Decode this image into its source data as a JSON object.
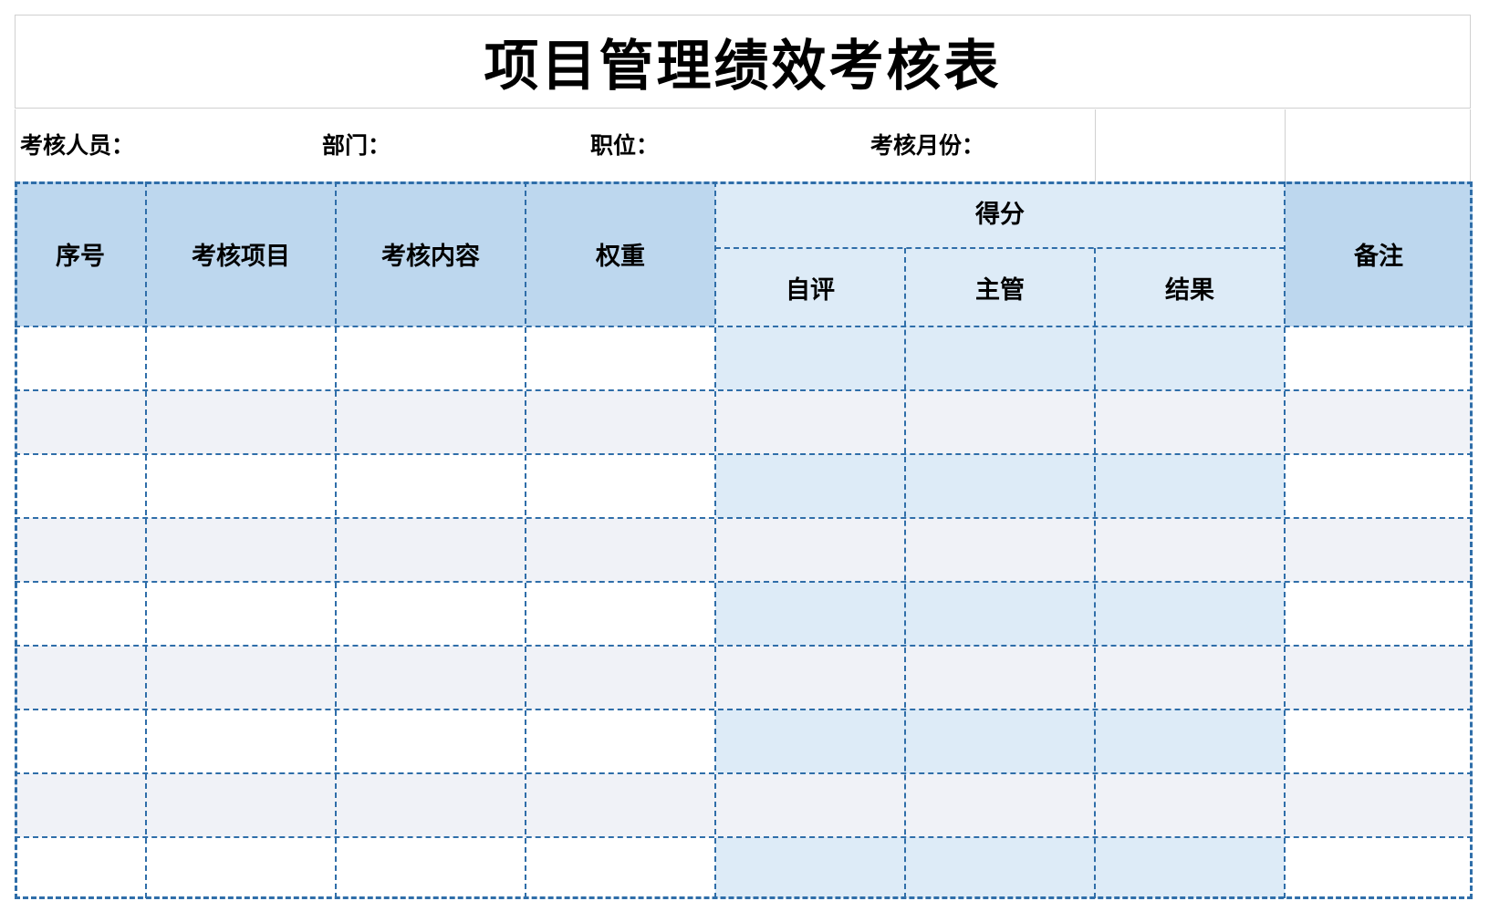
{
  "title": "项目管理绩效考核表",
  "info": {
    "reviewer_label": "考核人员：",
    "department_label": "部门：",
    "position_label": "职位：",
    "month_label": "考核月份："
  },
  "header": {
    "index": "序号",
    "item": "考核项目",
    "content": "考核内容",
    "weight": "权重",
    "score_group": "得分",
    "self_eval": "自评",
    "supervisor": "主管",
    "result": "结果",
    "remarks": "备注"
  },
  "rows": [
    {
      "index": "",
      "item": "",
      "content": "",
      "weight": "",
      "self_eval": "",
      "supervisor": "",
      "result": "",
      "remarks": ""
    },
    {
      "index": "",
      "item": "",
      "content": "",
      "weight": "",
      "self_eval": "",
      "supervisor": "",
      "result": "",
      "remarks": ""
    },
    {
      "index": "",
      "item": "",
      "content": "",
      "weight": "",
      "self_eval": "",
      "supervisor": "",
      "result": "",
      "remarks": ""
    },
    {
      "index": "",
      "item": "",
      "content": "",
      "weight": "",
      "self_eval": "",
      "supervisor": "",
      "result": "",
      "remarks": ""
    },
    {
      "index": "",
      "item": "",
      "content": "",
      "weight": "",
      "self_eval": "",
      "supervisor": "",
      "result": "",
      "remarks": ""
    },
    {
      "index": "",
      "item": "",
      "content": "",
      "weight": "",
      "self_eval": "",
      "supervisor": "",
      "result": "",
      "remarks": ""
    },
    {
      "index": "",
      "item": "",
      "content": "",
      "weight": "",
      "self_eval": "",
      "supervisor": "",
      "result": "",
      "remarks": ""
    },
    {
      "index": "",
      "item": "",
      "content": "",
      "weight": "",
      "self_eval": "",
      "supervisor": "",
      "result": "",
      "remarks": ""
    },
    {
      "index": "",
      "item": "",
      "content": "",
      "weight": "",
      "self_eval": "",
      "supervisor": "",
      "result": "",
      "remarks": ""
    }
  ],
  "colors": {
    "header_main": "#bdd7ee",
    "header_score": "#ddebf7",
    "row_alt": "#f0f2f7",
    "border": "#2f6ea9"
  }
}
